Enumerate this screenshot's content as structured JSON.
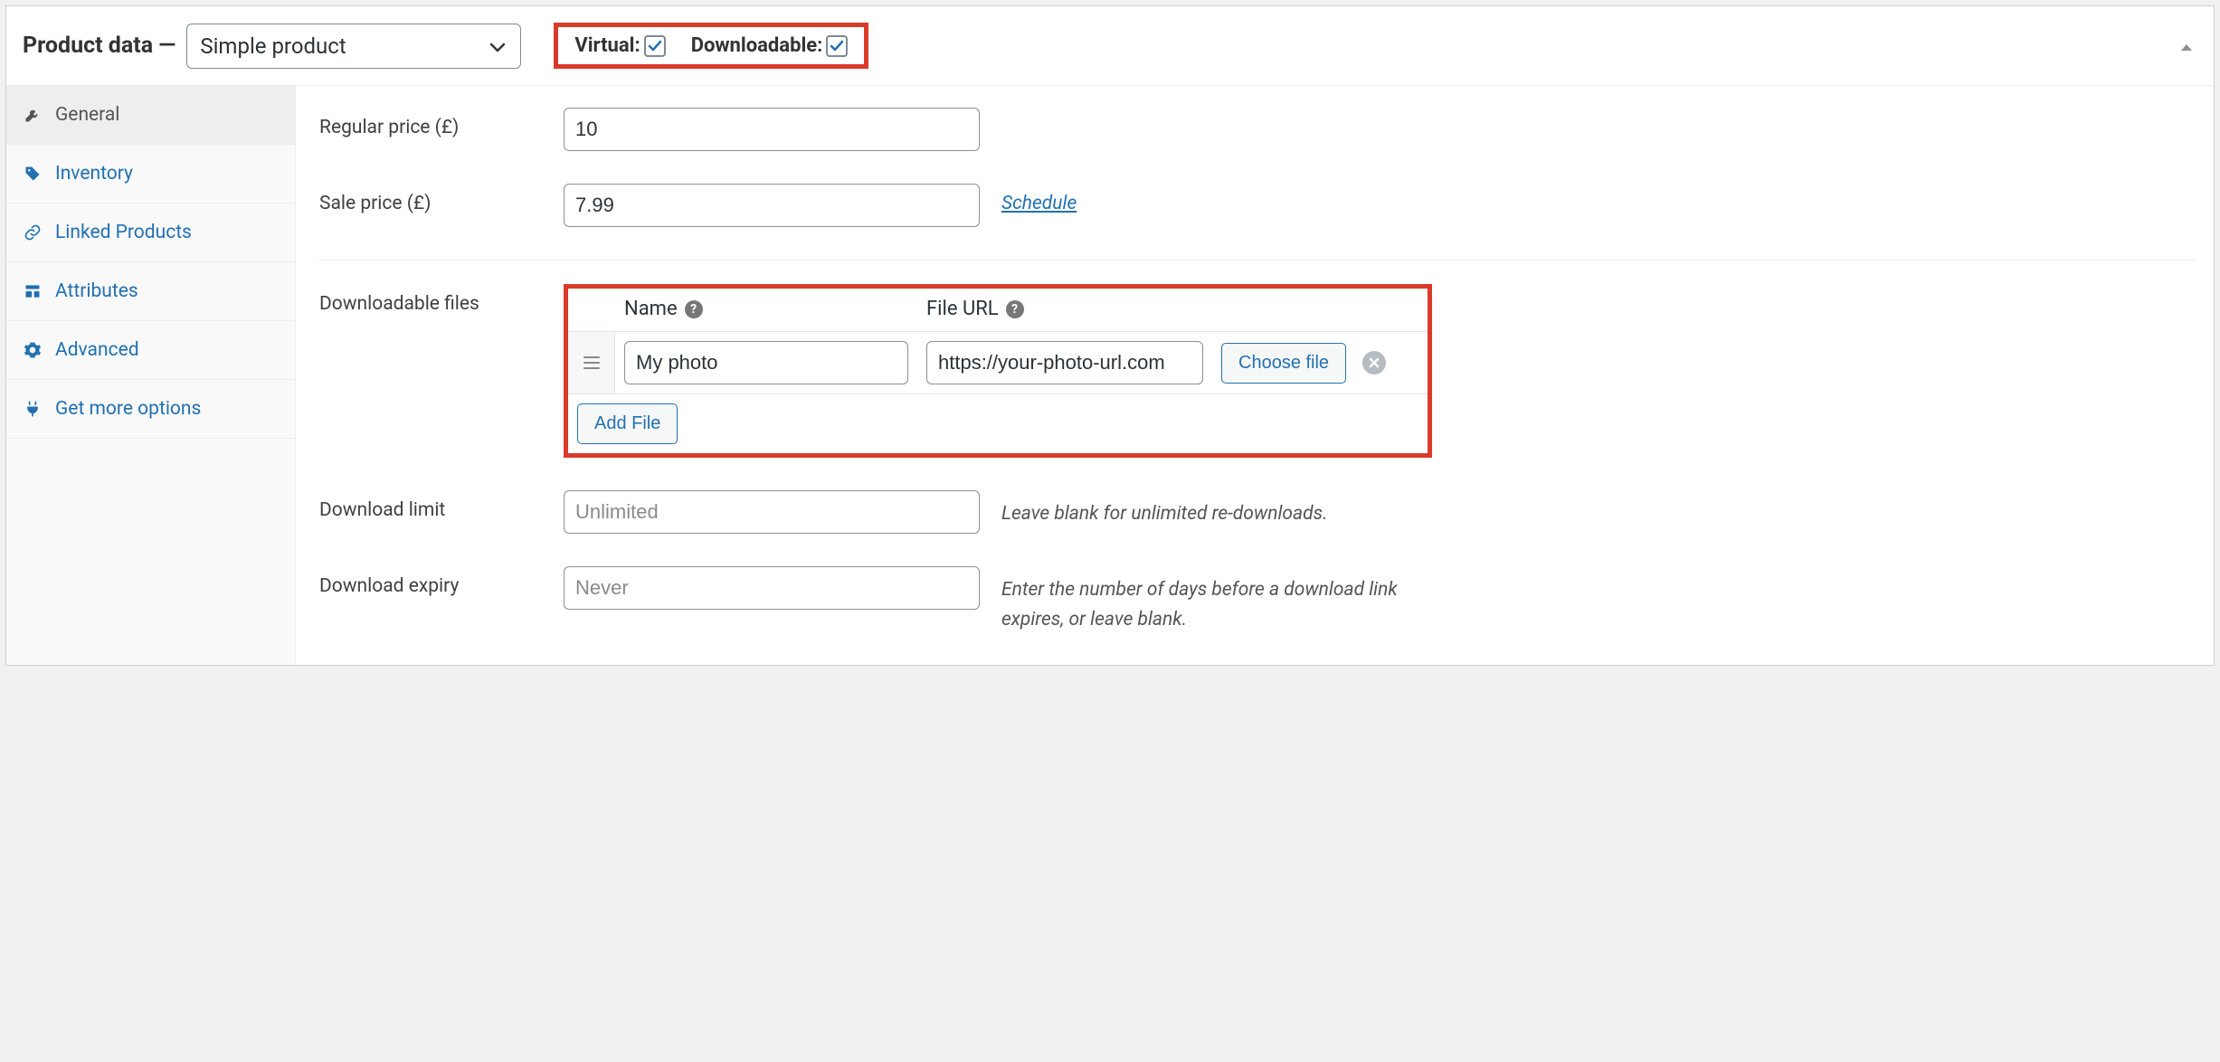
{
  "header": {
    "title": "Product data —",
    "product_type": "Simple product",
    "virtual_label": "Virtual:",
    "virtual_checked": true,
    "downloadable_label": "Downloadable:",
    "downloadable_checked": true
  },
  "sidebar": {
    "items": [
      {
        "label": "General",
        "active": true
      },
      {
        "label": "Inventory",
        "active": false
      },
      {
        "label": "Linked Products",
        "active": false
      },
      {
        "label": "Attributes",
        "active": false
      },
      {
        "label": "Advanced",
        "active": false
      },
      {
        "label": "Get more options",
        "active": false
      }
    ]
  },
  "fields": {
    "regular_price_label": "Regular price (£)",
    "regular_price_value": "10",
    "sale_price_label": "Sale price (£)",
    "sale_price_value": "7.99",
    "schedule_link": "Schedule",
    "downloadable_files_label": "Downloadable files",
    "files_header_name": "Name",
    "files_header_url": "File URL",
    "file_rows": [
      {
        "name": "My photo",
        "url": "https://your-photo-url.com"
      }
    ],
    "choose_file_btn": "Choose file",
    "add_file_btn": "Add File",
    "download_limit_label": "Download limit",
    "download_limit_placeholder": "Unlimited",
    "download_limit_help": "Leave blank for unlimited re-downloads.",
    "download_expiry_label": "Download expiry",
    "download_expiry_placeholder": "Never",
    "download_expiry_help": "Enter the number of days before a download link expires, or leave blank."
  }
}
